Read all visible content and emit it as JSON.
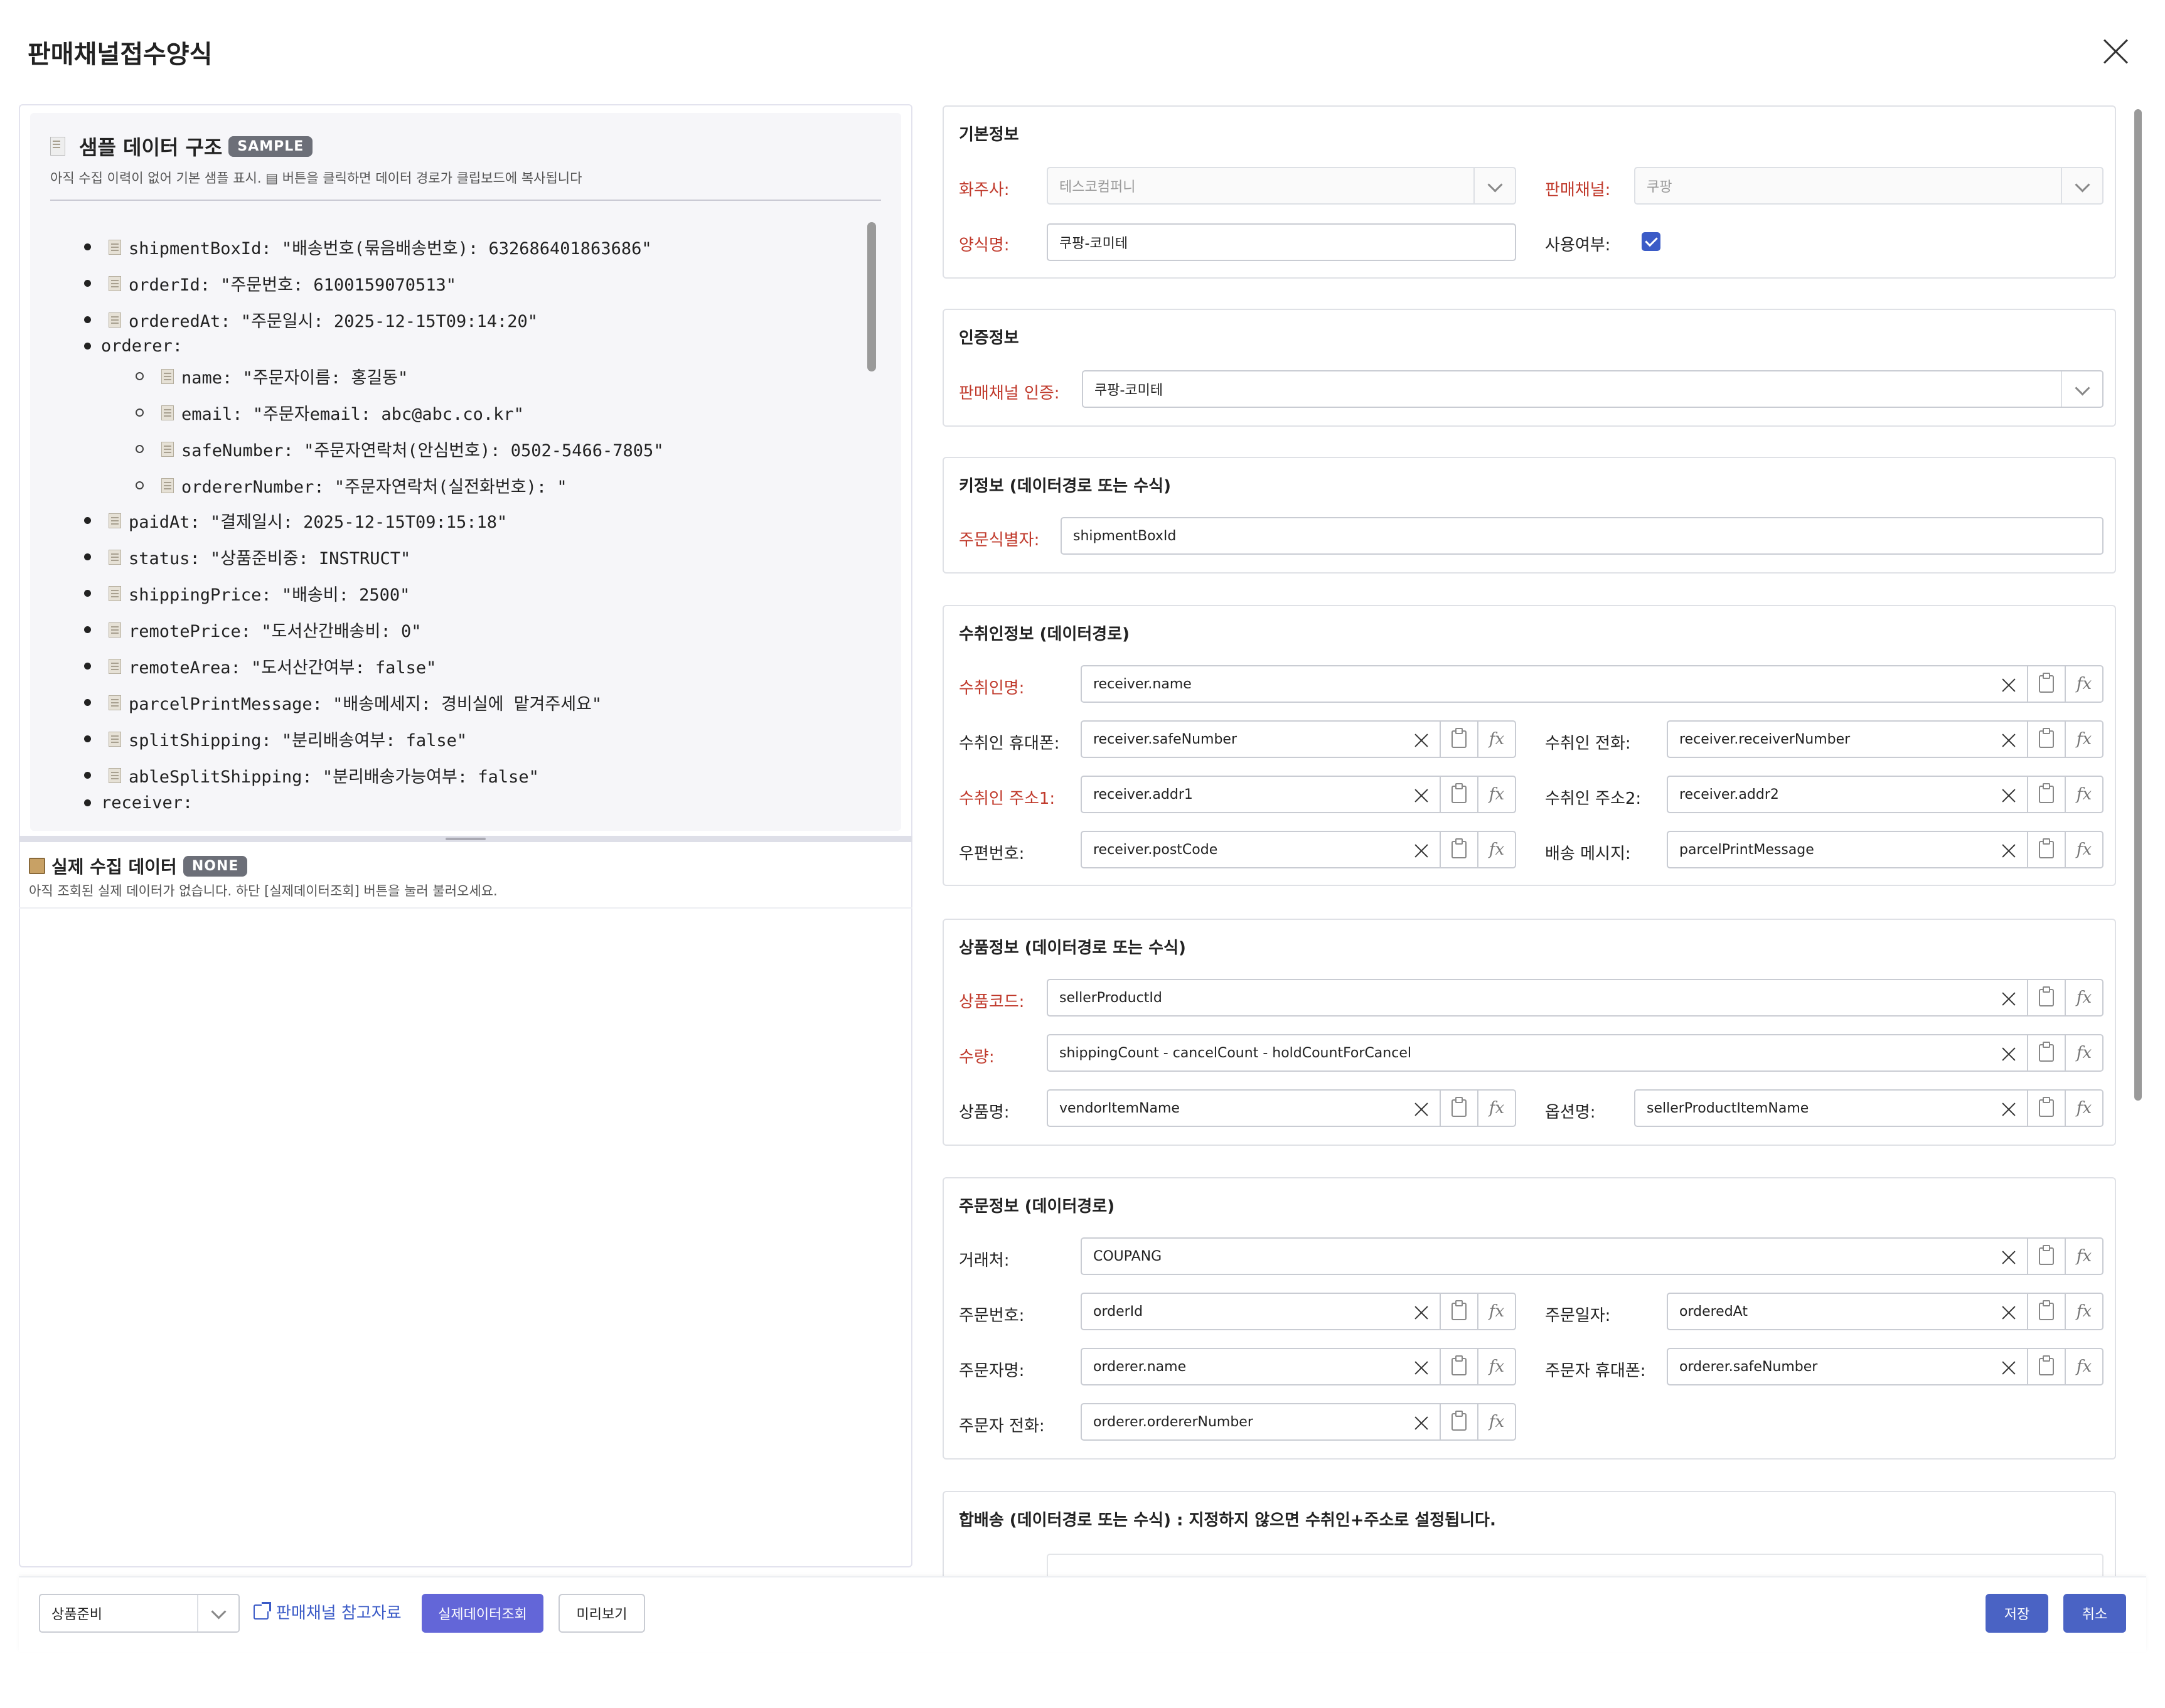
{
  "dialog": {
    "title": "판매채널접수양식"
  },
  "sample": {
    "title": "샘플 데이터 구조",
    "badge": "SAMPLE",
    "description": "아직 수집 이력이 없어 기본 샘플 표시. ▤ 버튼을 클릭하면 데이터 경로가 클립보드에 복사됩니다",
    "tree": [
      {
        "level": 1,
        "icon": true,
        "text": "shipmentBoxId: \"배송번호(묶음배송번호): 632686401863686\""
      },
      {
        "level": 1,
        "icon": true,
        "text": "orderId: \"주문번호: 6100159070513\""
      },
      {
        "level": 1,
        "icon": true,
        "text": "orderedAt: \"주문일시: 2025-12-15T09:14:20\""
      },
      {
        "level": 1,
        "icon": false,
        "text": "orderer:"
      },
      {
        "level": 2,
        "icon": true,
        "text": "name: \"주문자이름: 홍길동\""
      },
      {
        "level": 2,
        "icon": true,
        "text": "email: \"주문자email: abc@abc.co.kr\""
      },
      {
        "level": 2,
        "icon": true,
        "text": "safeNumber: \"주문자연락처(안심번호): 0502-5466-7805\""
      },
      {
        "level": 2,
        "icon": true,
        "text": "ordererNumber: \"주문자연락처(실전화번호): \""
      },
      {
        "level": 1,
        "icon": true,
        "text": "paidAt: \"결제일시: 2025-12-15T09:15:18\""
      },
      {
        "level": 1,
        "icon": true,
        "text": "status: \"상품준비중: INSTRUCT\""
      },
      {
        "level": 1,
        "icon": true,
        "text": "shippingPrice: \"배송비: 2500\""
      },
      {
        "level": 1,
        "icon": true,
        "text": "remotePrice: \"도서산간배송비: 0\""
      },
      {
        "level": 1,
        "icon": true,
        "text": "remoteArea: \"도서산간여부: false\""
      },
      {
        "level": 1,
        "icon": true,
        "text": "parcelPrintMessage: \"배송메세지: 경비실에 맡겨주세요\""
      },
      {
        "level": 1,
        "icon": true,
        "text": "splitShipping: \"분리배송여부: false\""
      },
      {
        "level": 1,
        "icon": true,
        "text": "ableSplitShipping: \"분리배송가능여부: false\""
      },
      {
        "level": 1,
        "icon": false,
        "text": "receiver:"
      }
    ]
  },
  "actual": {
    "title": "실제 수집 데이터",
    "badge": "NONE",
    "description": "아직 조회된 실제 데이터가 없습니다. 하단 [실제데이터조회] 버튼을 눌러 불러오세요."
  },
  "basic": {
    "title": "기본정보",
    "shipper_label": "화주사:",
    "shipper_value": "테스코컴퍼니",
    "channel_label": "판매채널:",
    "channel_value": "쿠팡",
    "form_label": "양식명:",
    "form_value": "쿠팡-코미테",
    "use_label": "사용여부:",
    "use_checked": true
  },
  "auth": {
    "title": "인증정보",
    "label": "판매채널 인증:",
    "value": "쿠팡-코미테"
  },
  "key": {
    "title": "키정보 (데이터경로 또는 수식)",
    "label": "주문식별자:",
    "value": "shipmentBoxId"
  },
  "receiver": {
    "title": "수취인정보 (데이터경로)",
    "name_label": "수취인명:",
    "name_value": "receiver.name",
    "mobile_label": "수취인 휴대폰:",
    "mobile_value": "receiver.safeNumber",
    "phone_label": "수취인 전화:",
    "phone_value": "receiver.receiverNumber",
    "addr1_label": "수취인 주소1:",
    "addr1_value": "receiver.addr1",
    "addr2_label": "수취인 주소2:",
    "addr2_value": "receiver.addr2",
    "zip_label": "우편번호:",
    "zip_value": "receiver.postCode",
    "msg_label": "배송 메시지:",
    "msg_value": "parcelPrintMessage"
  },
  "product": {
    "title": "상품정보 (데이터경로 또는 수식)",
    "code_label": "상품코드:",
    "code_value": "sellerProductId",
    "qty_label": "수량:",
    "qty_value": "shippingCount - cancelCount - holdCountForCancel",
    "name_label": "상품명:",
    "name_value": "vendorItemName",
    "option_label": "옵션명:",
    "option_value": "sellerProductItemName"
  },
  "order": {
    "title": "주문정보 (데이터경로)",
    "vendor_label": "거래처:",
    "vendor_value": "COUPANG",
    "no_label": "주문번호:",
    "no_value": "orderId",
    "date_label": "주문일자:",
    "date_value": "orderedAt",
    "orderer_label": "주문자명:",
    "orderer_value": "orderer.name",
    "orderer_mobile_label": "주문자 휴대폰:",
    "orderer_mobile_value": "orderer.safeNumber",
    "orderer_phone_label": "주문자 전화:",
    "orderer_phone_value": "orderer.ordererNumber"
  },
  "merge": {
    "title": "합배송 (데이터경로 또는 수식) : 지정하지 않으면 수취인+주소로 설정됩니다."
  },
  "footer": {
    "status_select": "상품준비",
    "reference_link": "판매채널 참고자료",
    "fetch_button": "실제데이터조회",
    "preview_button": "미리보기",
    "save_button": "저장",
    "cancel_button": "취소"
  },
  "colors": {
    "required": "#c0392b",
    "primary": "#6366d8",
    "accent": "#4a63c4"
  }
}
